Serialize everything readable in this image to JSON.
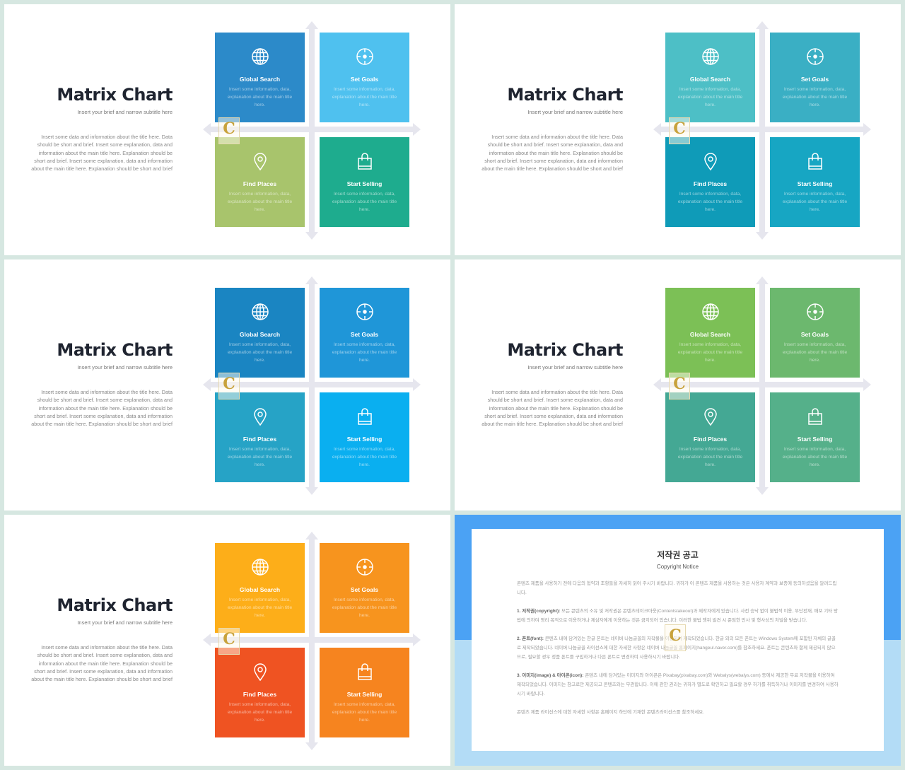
{
  "slide_common": {
    "title": "Matrix Chart",
    "subtitle": "Insert your brief and narrow subtitle here",
    "body": "Insert some data and information about the title here. Data should be short and brief. Insert some explanation, data and information about the main title here. Explanation should be short and brief. Insert some explanation, data and information about the main title here. Explanation should be short and brief",
    "watermark": "C"
  },
  "quadrants": [
    {
      "title": "Global Search",
      "text": "Insert some information, data, explanation about the main title here.",
      "icon": "globe-icon"
    },
    {
      "title": "Set Goals",
      "text": "Insert some information, data, explanation about the main title here.",
      "icon": "target-icon"
    },
    {
      "title": "Find Places",
      "text": "Insert some information, data, explanation about the main title here.",
      "icon": "map-pin-icon"
    },
    {
      "title": "Start Selling",
      "text": "Insert some information, data, explanation about the main title here.",
      "icon": "shopping-bag-icon"
    }
  ],
  "slides": [
    {
      "colors": [
        "#2c8ac9",
        "#4fc1ef",
        "#a8c46c",
        "#1eac8e"
      ]
    },
    {
      "colors": [
        "#4dbfc6",
        "#3aafc4",
        "#0f9bb8",
        "#17a6c3"
      ]
    },
    {
      "colors": [
        "#1a85c2",
        "#1f96d8",
        "#26a3c6",
        "#0aaff0"
      ]
    },
    {
      "colors": [
        "#7cc056",
        "#6cb86e",
        "#44a894",
        "#55b08a"
      ]
    },
    {
      "colors": [
        "#fdae19",
        "#f7941e",
        "#ef5322",
        "#f6841f"
      ]
    }
  ],
  "copyright": {
    "title": "저작권 공고",
    "subtitle": "Copyright Notice",
    "intro": "콘텐츠 제품을 사용하기 전에 다음의 협약과 조항들을 자세히 읽어 주시기 바랍니다. 귀하가 이 콘텐츠 제품을 사용하는 것은 사용자 계약과 보증에 동의하셨음을 알려드립니다.",
    "s1_head": "1. 저작권(copyright):",
    "s1": " 모든 콘텐츠의 소유 및 저작권은 콘텐츠테이크아웃(Contentstakeout)과 제작자에게 있습니다. 사전 승낙 없이 불법적 이용, 무단전재, 배포 기타 방법에 의하여 영리 목적으로 이용하거나 제삼자에게 이용하는 것은 금지되어 있습니다. 이러한 불법 행위 발견 시 준엄한 민사 및 형사상의 처벌을 받습니다.",
    "s2_head": "2. 폰트(font):",
    "s2": " 콘텐츠 내에 담겨있는 한글 폰트는 네이버 나눔글꼴의 저작물을 이용하여 제작되었습니다. 한글 외의 모든 폰트는 Windows System에 포함된 자체의 글꼴로 제작되었습니다. 네이버 나눔글꼴 라이선스에 대한 자세한 사항은 네이버 나눔글꼴 홈페이지(hangeul.naver.com)를 참조하세요. 폰트는 콘텐츠와 함께 제공되지 않으므로, 필요할 경우 정품 폰트를 구입하거나 다른 폰트로 변경하여 사용하시기 바랍니다.",
    "s3_head": "3. 이미지(image) & 아이콘(icon):",
    "s3": " 콘텐츠 내에 담겨있는 이미지와 아이콘은 Pixabay(pixabay.com)와 Webalys(webalys.com) 등에서 제공한 무료 저작물을 이용하여 제작되었습니다. 이미지는 참고로만 제공되고 콘텐츠와는 무관합니다. 이에 관한 권리는 귀하가 별도로 확인하고 필요할 경우 허가를 취득하거나 이미지를 변경하여 사용하시기 바랍니다.",
    "outro": "콘텐츠 제품 라이선스에 대한 자세한 사항은 홈페이지 하단에 기재한 콘텐츠라이선스를 참조하세요."
  }
}
